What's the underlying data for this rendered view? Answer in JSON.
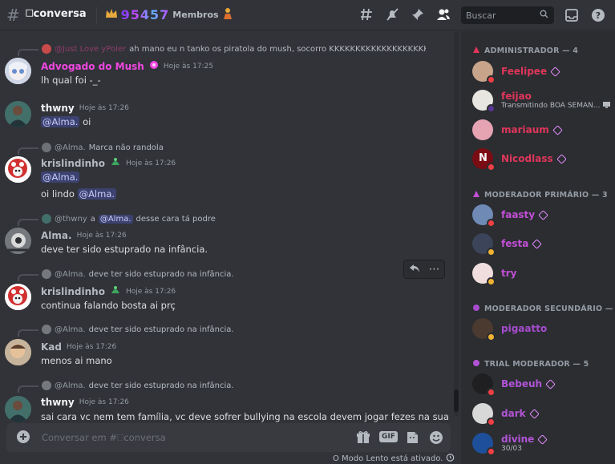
{
  "header": {
    "channel_name": "🗆conversa",
    "members_count": "95457",
    "members_label": "Membros",
    "search_placeholder": "Buscar"
  },
  "messages": [
    {
      "reply_name": "@Just Love yPoler",
      "reply_text": "ah mano eu n tanko os piratola do mush, socorro KKKKKKKKKKKKKKKKKKKKK",
      "name": "Advogado do Mush",
      "time": "Hoje às 17:25",
      "text": "lh qual foi -_-"
    },
    {
      "name": "thwny",
      "time": "Hoje às 17:26",
      "mention": "@Alma.",
      "text": "oi"
    },
    {
      "reply_name": "@Alma.",
      "reply_text": "Marca não randola",
      "name": "krislindinho",
      "time": "Hoje às 17:26",
      "mention": "@Alma.",
      "text2": "oi lindo",
      "mention2": "@Alma."
    },
    {
      "reply_name": "@thwny",
      "reply_mid": "a",
      "reply_mention": "@Alma.",
      "reply_text": "desse cara tá podre",
      "name": "Alma.",
      "time": "Hoje às 17:26",
      "text": "deve ter sido estuprado na infância."
    },
    {
      "reply_name": "@Alma.",
      "reply_text": "deve ter sido estuprado na infância.",
      "name": "krislindinho",
      "time": "Hoje às 17:26",
      "text": "continua falando bosta ai prç"
    },
    {
      "reply_name": "@Alma.",
      "reply_text": "deve ter sido estuprado na infância.",
      "name": "Kad",
      "time": "Hoje às 17:26",
      "text": "menos ai mano"
    },
    {
      "reply_name": "@Alma.",
      "reply_text": "deve ter sido estuprado na infância.",
      "name": "thwny",
      "time": "Hoje às 17:26",
      "text": "sai cara vc nem tem família, vc deve sofrer bullying na escola devem jogar fezes na sua"
    }
  ],
  "composer": {
    "placeholder": "Conversar em #🗆conversa",
    "gif_label": "GIF",
    "slowmode": "O Modo Lento está ativado."
  },
  "sidebar": {
    "roles": [
      {
        "label": "ADMINISTRADOR — 4",
        "color": "#e0365a"
      },
      {
        "label": "MODERADOR PRIMÁRIO — 3",
        "color": "#c24fd6"
      },
      {
        "label": "MODERADOR SECUNDÁRIO — 1",
        "color": "#a64ccf"
      },
      {
        "label": "TRIAL MODERADOR — 5",
        "color": "#b154d6"
      }
    ],
    "members": [
      {
        "name": "Feelipee",
        "color": "#e0365a"
      },
      {
        "name": "feijao",
        "color": "#e0365a",
        "sub": "Transmitindo BOA SEMAN..."
      },
      {
        "name": "mariaum",
        "color": "#e0365a"
      },
      {
        "name": "Nicodlass",
        "color": "#e0365a"
      },
      {
        "name": "faasty",
        "color": "#c24fd6"
      },
      {
        "name": "festa",
        "color": "#c24fd6"
      },
      {
        "name": "try",
        "color": "#c24fd6"
      },
      {
        "name": "pigaatto",
        "color": "#a64ccf"
      },
      {
        "name": "Bebeuh",
        "color": "#b154d6"
      },
      {
        "name": "dark",
        "color": "#b154d6"
      },
      {
        "name": "divine",
        "color": "#b154d6",
        "sub": "30/03"
      }
    ]
  },
  "colors": {
    "accent_pink": "#f047e0",
    "mention_bg": "#3c4270",
    "sidebar_bg": "#2b2d31",
    "chat_bg": "#313338"
  }
}
